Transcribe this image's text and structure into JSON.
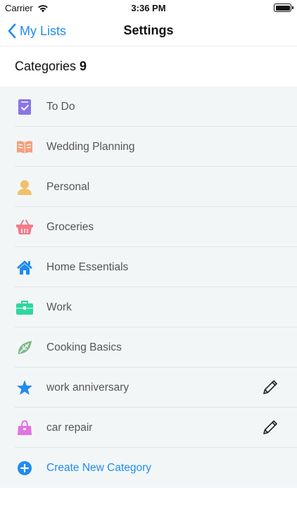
{
  "status": {
    "carrier": "Carrier",
    "time": "3:36 PM"
  },
  "nav": {
    "back_label": "My Lists",
    "title": "Settings"
  },
  "categories": {
    "label": "Categories",
    "count": "9",
    "items": [
      {
        "label": "To Do",
        "icon": "todo-note-icon",
        "color": "#8a74e8"
      },
      {
        "label": "Wedding Planning",
        "icon": "open-book-icon",
        "color": "#f4a07c"
      },
      {
        "label": "Personal",
        "icon": "person-icon",
        "color": "#f0c16a"
      },
      {
        "label": "Groceries",
        "icon": "basket-icon",
        "color": "#f27b8a"
      },
      {
        "label": "Home Essentials",
        "icon": "house-icon",
        "color": "#1e8cf0"
      },
      {
        "label": "Work",
        "icon": "briefcase-icon",
        "color": "#2fd6a0"
      },
      {
        "label": "Cooking Basics",
        "icon": "leaf-icon",
        "color": "#7dbb8a"
      },
      {
        "label": "work anniversary",
        "icon": "star-icon",
        "color": "#1e8cf0",
        "editable": true
      },
      {
        "label": "car repair",
        "icon": "handbag-icon",
        "color": "#e273e3",
        "editable": true
      }
    ],
    "create_label": "Create New Category"
  },
  "colors": {
    "accent": "#1e8cf0",
    "list_background": "#f3f6f7"
  }
}
